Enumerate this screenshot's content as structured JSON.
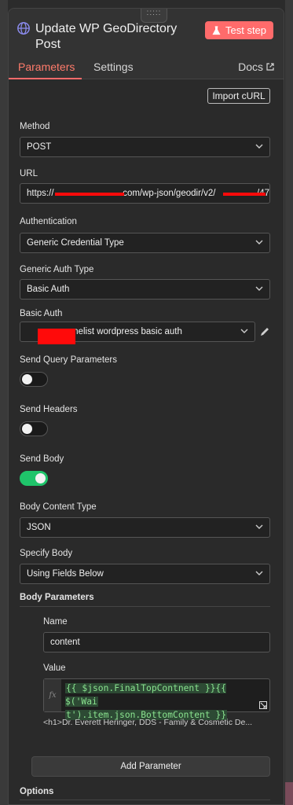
{
  "node": {
    "title": "Update WP GeoDirectory Post",
    "test_step_label": "Test step",
    "drag_handle": ":::::"
  },
  "tabs": {
    "parameters": "Parameters",
    "settings": "Settings",
    "docs": "Docs"
  },
  "import_curl_label": "Import cURL",
  "method": {
    "label": "Method",
    "value": "POST"
  },
  "url": {
    "label": "URL",
    "value_prefix": "https://",
    "value_middle": ".com/wp-json/geodir/v2/",
    "value_suffix": "/47"
  },
  "authentication": {
    "label": "Authentication",
    "value": "Generic Credential Type"
  },
  "generic_auth_type": {
    "label": "Generic Auth Type",
    "value": "Basic Auth"
  },
  "basic_auth": {
    "label": "Basic Auth",
    "value": "melist wordpress basic auth"
  },
  "send_query": {
    "label": "Send Query Parameters",
    "enabled": false
  },
  "send_headers": {
    "label": "Send Headers",
    "enabled": false
  },
  "send_body": {
    "label": "Send Body",
    "enabled": true
  },
  "body_content_type": {
    "label": "Body Content Type",
    "value": "JSON"
  },
  "specify_body": {
    "label": "Specify Body",
    "value": "Using Fields Below"
  },
  "body_parameters": {
    "label": "Body Parameters",
    "name_label": "Name",
    "name_value": "content",
    "value_label": "Value",
    "fx_label": "fx",
    "code_line1": "{{ $json.FinalTopContnent }}{{ $('Wai",
    "code_line2": "t').item.json.BottomContent }}",
    "preview": "<h1>Dr. Everett Heringer, DDS - Family & Cosmetic De..."
  },
  "add_parameter_label": "Add Parameter",
  "options_label": "Options",
  "colors": {
    "accent": "#ff6b6b",
    "toggle_on": "#1fc46a",
    "redaction": "#ff0a0a"
  }
}
